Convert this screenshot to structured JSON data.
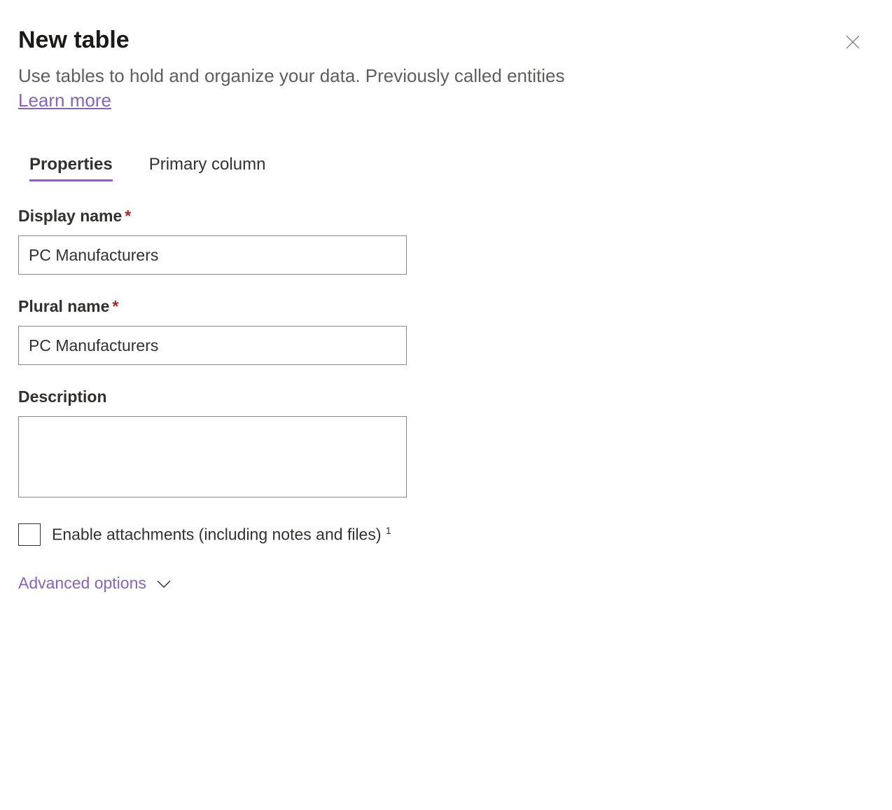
{
  "header": {
    "title": "New table",
    "subtitle": "Use tables to hold and organize your data. Previously called entities",
    "learn_more": "Learn more"
  },
  "tabs": [
    {
      "label": "Properties",
      "active": true
    },
    {
      "label": "Primary column",
      "active": false
    }
  ],
  "form": {
    "display_name": {
      "label": "Display name",
      "required_mark": "*",
      "value": "PC Manufacturers"
    },
    "plural_name": {
      "label": "Plural name",
      "required_mark": "*",
      "value": "PC Manufacturers"
    },
    "description": {
      "label": "Description",
      "value": ""
    },
    "enable_attachments": {
      "label": "Enable attachments (including notes and files)",
      "footnote": "1",
      "checked": false
    },
    "advanced_options": "Advanced options"
  }
}
